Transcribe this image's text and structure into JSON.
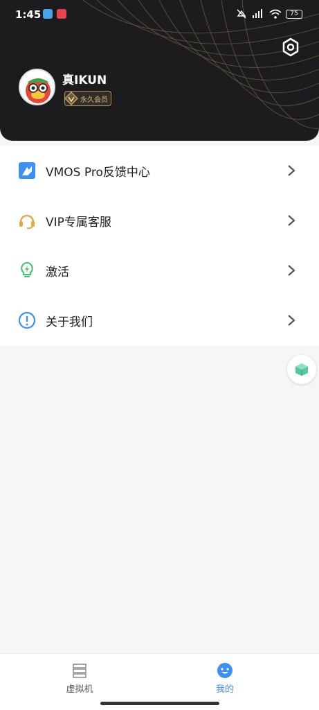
{
  "status_bar": {
    "time": "1:45",
    "battery": "75",
    "icons": [
      "app-notification-icon",
      "app-notification-red-icon",
      "mute-icon",
      "hd-signal-icon",
      "wifi-icon",
      "battery-icon"
    ]
  },
  "profile": {
    "username": "真IKUN",
    "membership_badge": "永久会员"
  },
  "menu": {
    "items": [
      {
        "label": "VMOS Pro反馈中心",
        "icon": "feedback-icon"
      },
      {
        "label": "VIP专属客服",
        "icon": "headset-icon"
      },
      {
        "label": "激活",
        "icon": "activate-bulb-icon"
      },
      {
        "label": "关于我们",
        "icon": "info-icon"
      }
    ]
  },
  "bottom_nav": {
    "tabs": [
      {
        "label": "虚拟机",
        "icon": "server-icon",
        "active": false
      },
      {
        "label": "我的",
        "icon": "smile-icon",
        "active": true
      }
    ]
  },
  "colors": {
    "header_bg": "#1c1c1e",
    "accent_blue": "#3d8ff0",
    "gold": "#d7b67a",
    "page_bg": "#f6f6f7"
  }
}
